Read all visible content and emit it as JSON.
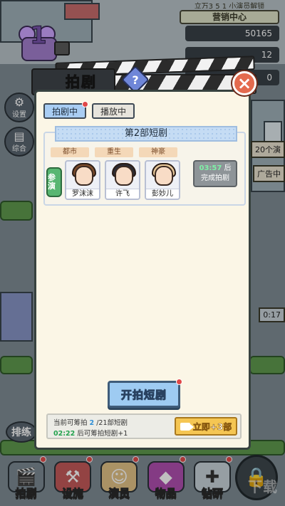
{
  "hud": {
    "top_strip": "立万3 5 1 小演员解锁",
    "center_label": "营销中心",
    "money": "50165",
    "count_a": "12",
    "count_b": "0"
  },
  "side_buttons": [
    {
      "label": "设置",
      "icon": "gear-icon"
    },
    {
      "label": "综合",
      "icon": "book-icon"
    }
  ],
  "bg_text": {
    "queue": "排练",
    "right_1": "20个演",
    "right_2": "广告中",
    "right_3": "0:17"
  },
  "clapper": {
    "title": "拍剧",
    "help": "?",
    "close": "×",
    "camera_level": "1"
  },
  "tabs": [
    {
      "label": "拍剧中",
      "active": true,
      "badge": true
    },
    {
      "label": "播放中",
      "active": false,
      "badge": false
    }
  ],
  "show": {
    "title": "第2部短剧",
    "genres": [
      "都市",
      "重生",
      "神豪"
    ],
    "cast_label": "参演",
    "actors": [
      {
        "name": "罗沫沫",
        "hair_color": "#7b4a2a"
      },
      {
        "name": "许飞",
        "hair_color": "#2c2c34"
      },
      {
        "name": "彭妙儿",
        "hair_color": "#e8c89a"
      }
    ],
    "finish_time": "03:57",
    "finish_after": "后",
    "finish_label": "完成拍剧"
  },
  "start_button": "开拍短剧",
  "info": {
    "prefix": "当前可筹拍",
    "current": "2",
    "suffix": "/21部短剧",
    "timer": "02:22",
    "timer_suffix": "后可筹拍短剧+1",
    "instant_button": "立即+3部"
  },
  "nav": [
    {
      "label": "拍剧",
      "icon": "clapper-icon",
      "badge": true
    },
    {
      "label": "设施",
      "icon": "sewing-machine-icon",
      "badge": true
    },
    {
      "label": "演员",
      "icon": "actress-icon",
      "badge": true
    },
    {
      "label": "物品",
      "icon": "gem-icon",
      "badge": true
    },
    {
      "label": "钻研",
      "icon": "puzzle-icon",
      "badge": true
    }
  ],
  "watermark": "下载"
}
